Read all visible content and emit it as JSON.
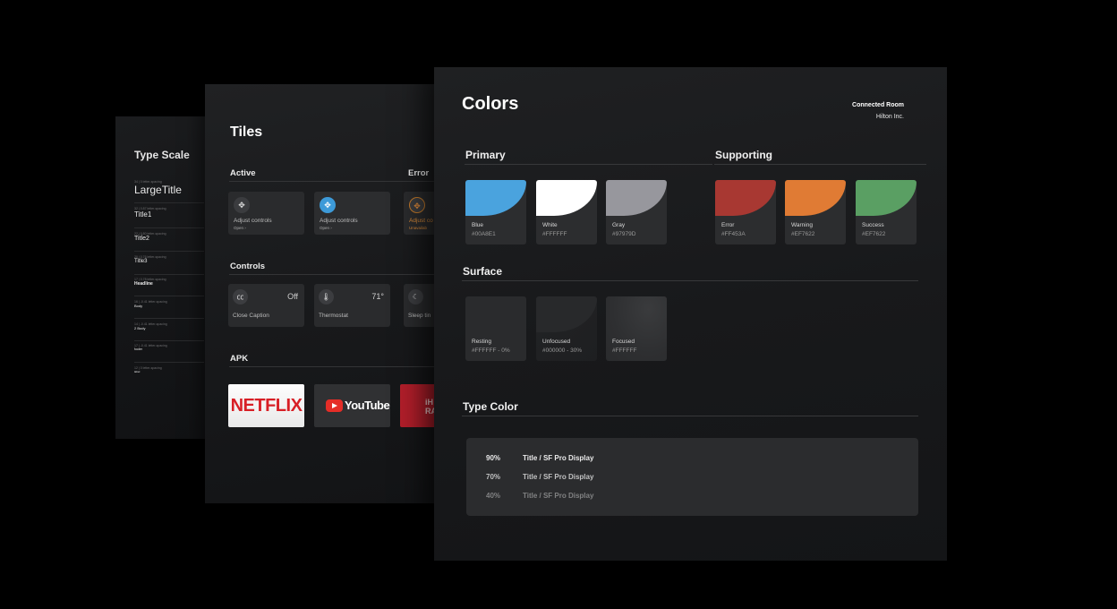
{
  "type_scale": {
    "title": "Type Scale",
    "rows": [
      {
        "meta": "34 | 0 letter-spacing",
        "name": "LargeTitle"
      },
      {
        "meta": "32 | 0.87 letter-spacing",
        "name": "Title1"
      },
      {
        "meta": "22 | 0.80 letter-spacing",
        "name": "Title2"
      },
      {
        "meta": "20 | 0.76 letter-spacing",
        "name": "Title3"
      },
      {
        "meta": "17 | 0.78 letter-spacing",
        "name": "Headline"
      },
      {
        "meta": "16 | -0.41 letter-spacing",
        "name": "Body"
      },
      {
        "meta": "14 | -0.41 letter-spacing",
        "name": "2 Body"
      },
      {
        "meta": "17 | -0.41 letter-spacing",
        "name": "footer"
      },
      {
        "meta": "12 | 0 letter-spacing",
        "name": "label"
      }
    ]
  },
  "tiles": {
    "title": "Tiles",
    "active_label": "Active",
    "error_label": "Error",
    "controls_label": "Controls",
    "apk_label": "APK",
    "active_tiles": [
      {
        "label": "Adjust controls",
        "sub": "Open  ›",
        "icon": "dpad-icon"
      },
      {
        "label": "Adjust controls",
        "sub": "Open  ›",
        "icon": "dpad-icon"
      }
    ],
    "error_tile": {
      "label": "Adjust co",
      "sub": "Unavailab",
      "icon": "dpad-icon"
    },
    "controls": [
      {
        "label": "Close Caption",
        "value": "Off",
        "icon": "cc-icon"
      },
      {
        "label": "Thermostat",
        "value": "71°",
        "icon": "thermometer-icon"
      },
      {
        "label": "Sleep tin",
        "value": "",
        "icon": "moon-icon"
      }
    ],
    "apks": {
      "netflix": "NETFLIX",
      "youtube": "YouTube",
      "iheart_line1": "iH",
      "iheart_line2": "RA"
    }
  },
  "colors": {
    "title": "Colors",
    "product": "Connected Room",
    "company": "Hilton Inc.",
    "primary_label": "Primary",
    "supporting_label": "Supporting",
    "surface_label": "Surface",
    "type_color_label": "Type  Color",
    "primary": [
      {
        "name": "Blue",
        "hex": "#00A8E1",
        "swatch": "#4aa3de"
      },
      {
        "name": "White",
        "hex": "#FFFFFF",
        "swatch": "#ffffff"
      },
      {
        "name": "Gray",
        "hex": "#97979D",
        "swatch": "#97979d"
      }
    ],
    "supporting": [
      {
        "name": "Error",
        "hex": "#FF453A",
        "swatch": "#a83832"
      },
      {
        "name": "Warning",
        "hex": "#EF7622",
        "swatch": "#e07b34"
      },
      {
        "name": "Success",
        "hex": "#EF7622",
        "swatch": "#5a9f63"
      }
    ],
    "surface": [
      {
        "name": "Resting",
        "hex": "#FFFFFF - 0%"
      },
      {
        "name": "Unfocused",
        "hex": "#000000 - 30%"
      },
      {
        "name": "Focused",
        "hex": "#FFFFFF"
      }
    ],
    "type_colors": [
      {
        "percent": "90%",
        "text": "Title / SF Pro Display",
        "opacity": 0.9
      },
      {
        "percent": "70%",
        "text": "Title / SF Pro Display",
        "opacity": 0.7
      },
      {
        "percent": "40%",
        "text": "Title / SF Pro Display",
        "opacity": 0.4
      }
    ]
  }
}
